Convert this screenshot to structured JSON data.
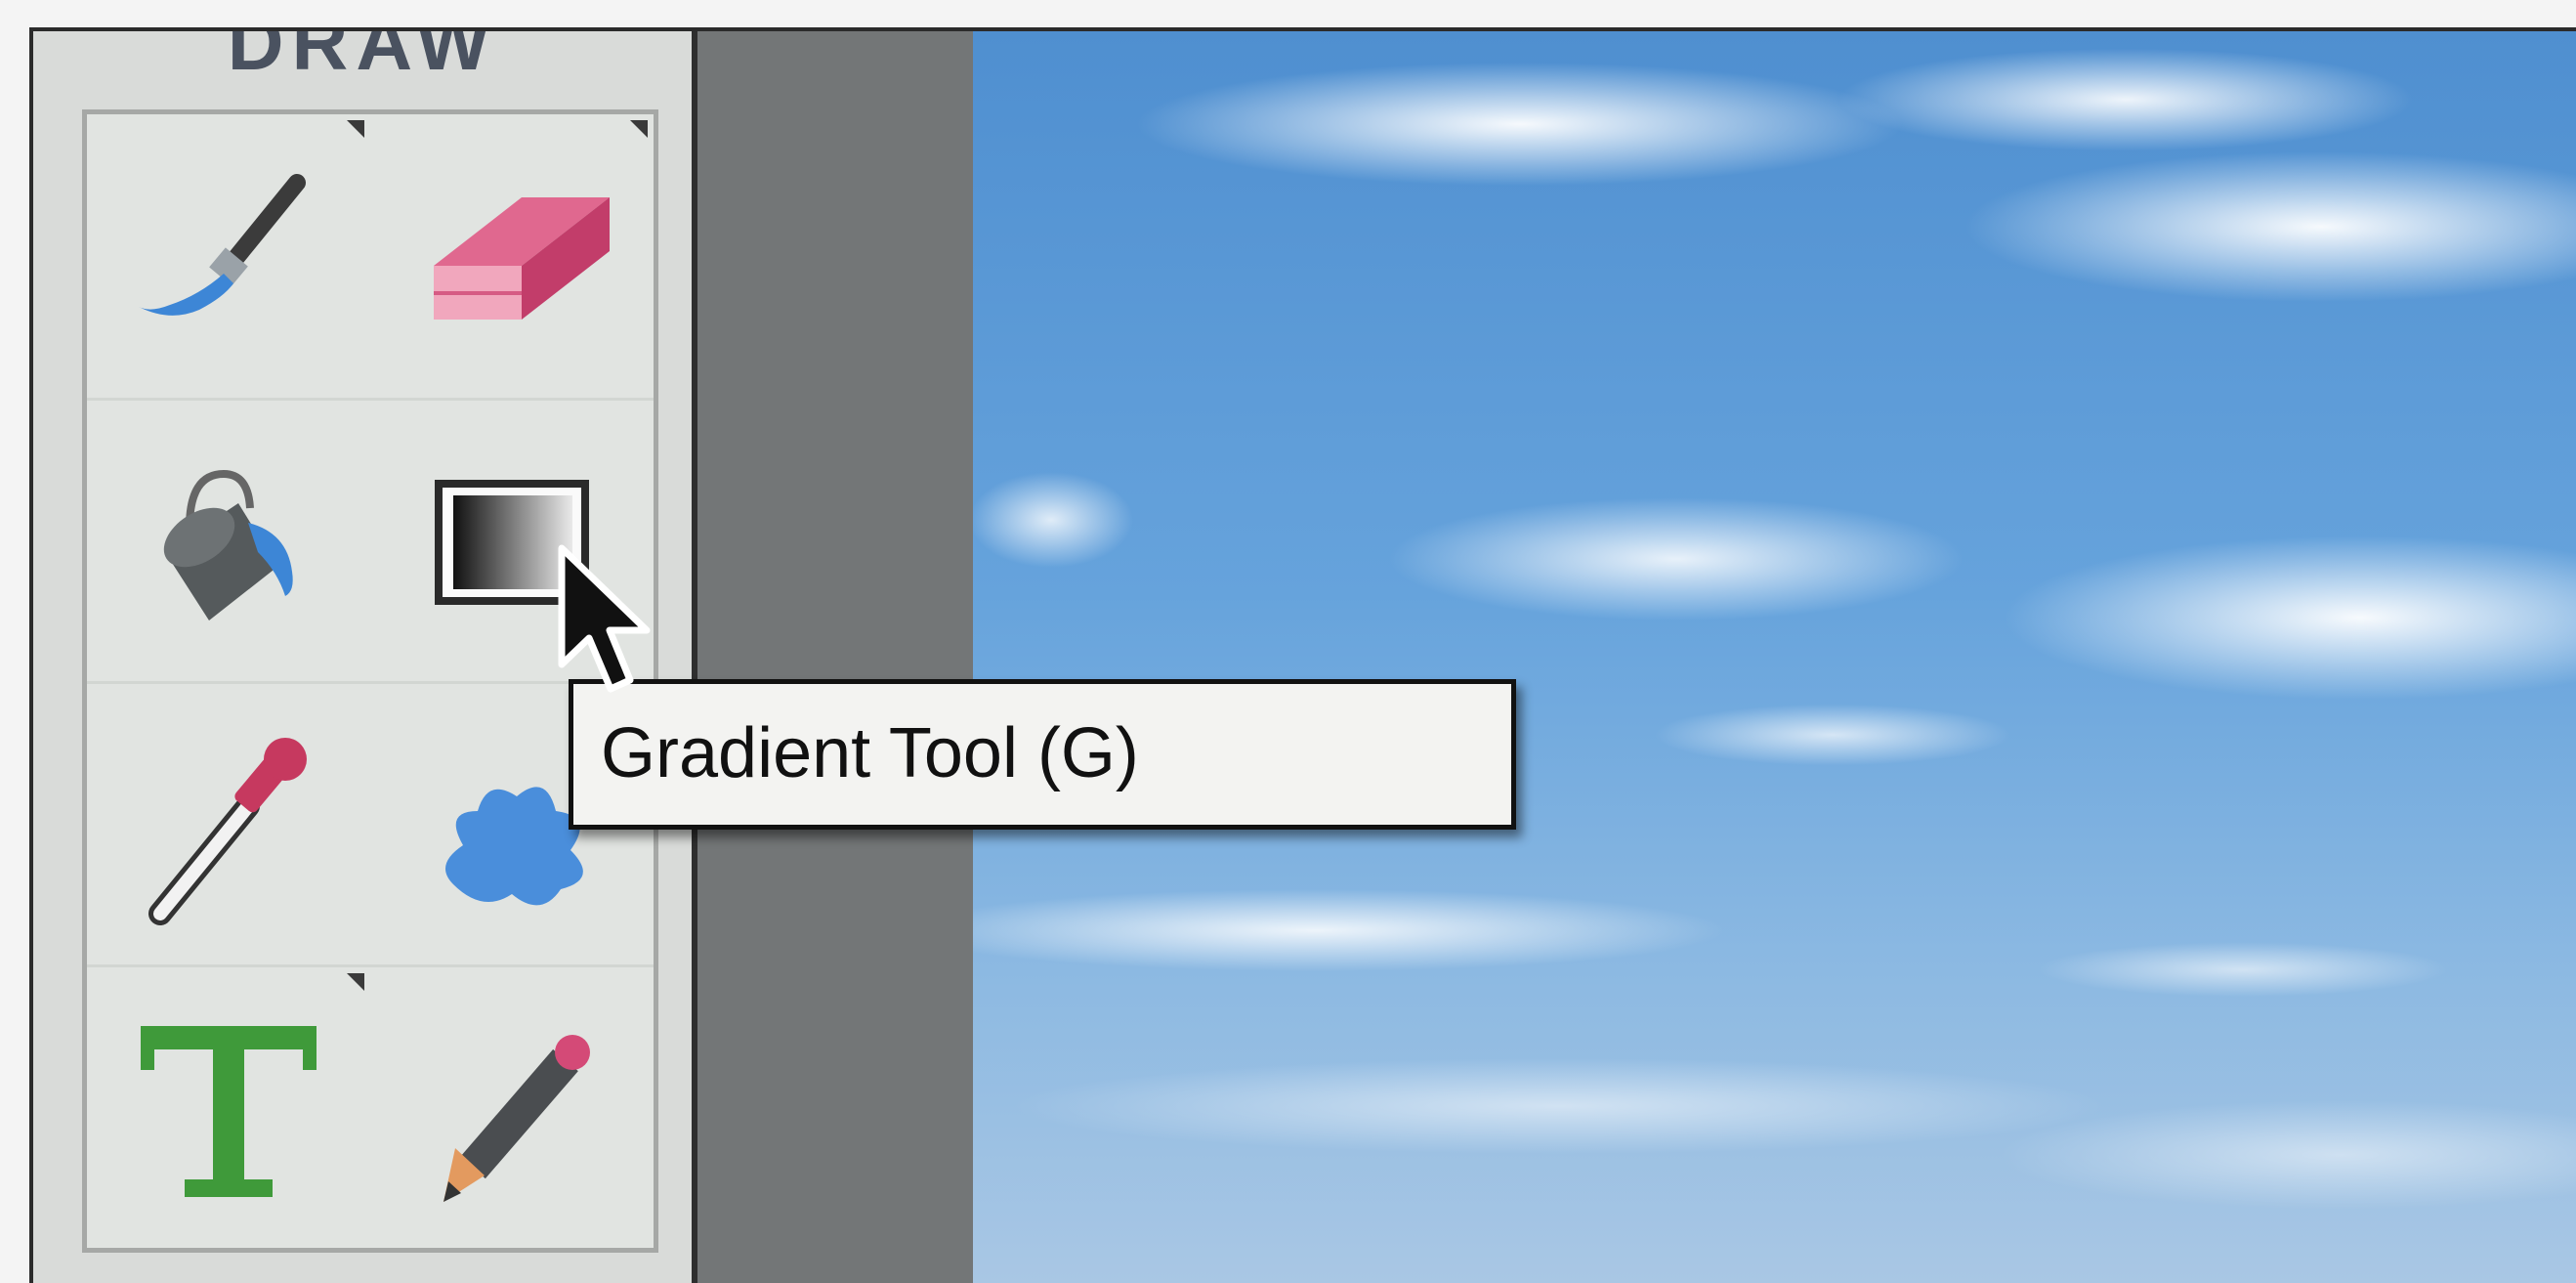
{
  "panel": {
    "section_title": "DRAW",
    "tools": [
      {
        "name": "Brush Tool",
        "icon": "brush-icon"
      },
      {
        "name": "Eraser Tool",
        "icon": "eraser-icon"
      },
      {
        "name": "Paint Bucket Tool",
        "icon": "paint-bucket-icon"
      },
      {
        "name": "Gradient Tool",
        "icon": "gradient-icon"
      },
      {
        "name": "Eyedropper Tool",
        "icon": "eyedropper-icon"
      },
      {
        "name": "Shape Tool",
        "icon": "shape-splat-icon"
      },
      {
        "name": "Type Tool",
        "icon": "type-icon"
      },
      {
        "name": "Pencil Tool",
        "icon": "pencil-icon"
      }
    ]
  },
  "tooltip": {
    "text": "Gradient Tool (G)"
  },
  "colors": {
    "panel": "#d9dbd9",
    "gutter": "#737677",
    "sky": "#66a3dc",
    "brush_blue": "#3d86d6",
    "eraser_pink": "#d64a78",
    "type_green": "#3f9a3a"
  }
}
